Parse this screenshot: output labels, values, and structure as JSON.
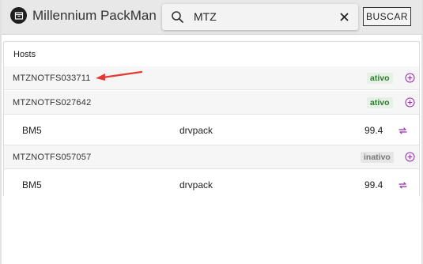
{
  "app": {
    "title": "Millennium PackMan"
  },
  "search": {
    "value": "MTZ",
    "button_label": "BUSCAR"
  },
  "panel": {
    "title": "Hosts",
    "hosts": [
      {
        "name": "MTZNOTFS033711",
        "status": "ativo",
        "packages": []
      },
      {
        "name": "MTZNOTFS027642",
        "status": "ativo",
        "packages": [
          {
            "name": "BM5",
            "type": "drvpack",
            "version": "99.4"
          }
        ]
      },
      {
        "name": "MTZNOTFS057057",
        "status": "inativo",
        "packages": [
          {
            "name": "BM5",
            "type": "drvpack",
            "version": "99.4"
          }
        ]
      }
    ]
  },
  "colors": {
    "accent": "#9c27b0",
    "active": "#2e7d32",
    "inactive": "#777777",
    "annotation": "#e53935"
  },
  "icons": {
    "logo": "package-icon",
    "search": "search-icon",
    "clear": "close-icon",
    "add": "add-circle-icon",
    "sync": "sync-icon",
    "annotation": "red-arrow"
  }
}
